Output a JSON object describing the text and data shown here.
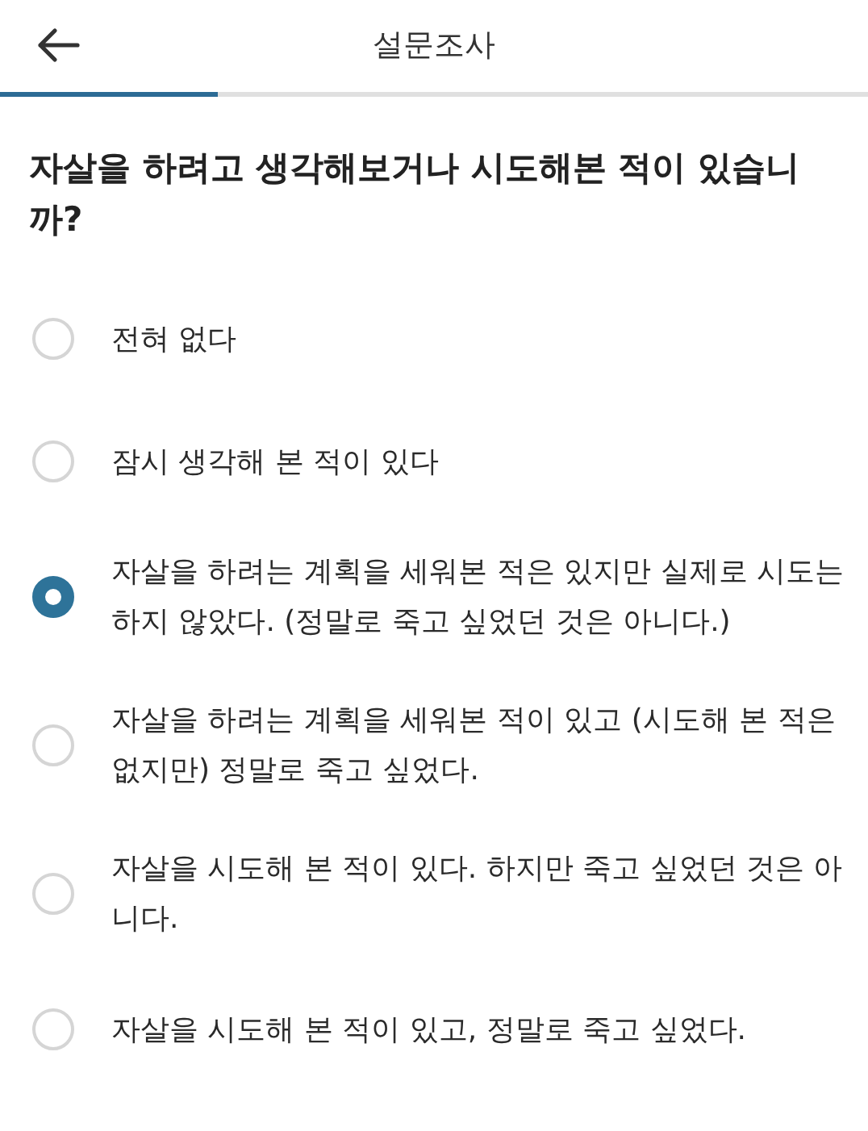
{
  "header": {
    "title": "설문조사"
  },
  "progress": {
    "level": 0.25
  },
  "question": "자살을 하려고 생각해보거나 시도해본 적이 있습니까?",
  "options": [
    {
      "label": "전혀 없다",
      "selected": false
    },
    {
      "label": "잠시 생각해 본 적이 있다",
      "selected": false
    },
    {
      "label": "자살을 하려는 계획을 세워본 적은 있지만 실제로 시도는 하지 않았다. (정말로 죽고 싶었던 것은 아니다.)",
      "selected": true
    },
    {
      "label": "자살을 하려는 계획을 세워본 적이 있고 (시도해 본 적은 없지만) 정말로 죽고 싶었다.",
      "selected": false
    },
    {
      "label": "자살을 시도해 본 적이 있다. 하지만 죽고 싶었던 것은 아니다.",
      "selected": false
    },
    {
      "label": "자살을 시도해 본 적이 있고, 정말로 죽고 싶었다.",
      "selected": false
    }
  ]
}
